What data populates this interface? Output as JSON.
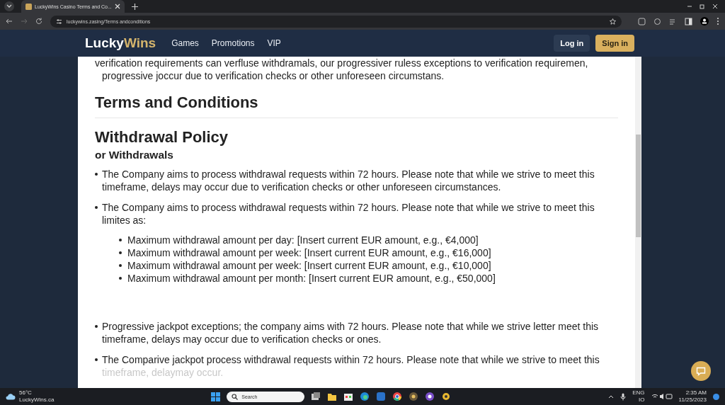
{
  "browser": {
    "tab_title": "LuckyWins Casino Terms and Co...",
    "url": "luckywins.zasing/Terms andconditions"
  },
  "site": {
    "logo_first": "Lucky",
    "logo_second": "Wins",
    "nav": [
      "Games",
      "Promotions",
      "VIP"
    ],
    "login": "Log in",
    "signin": "Sign in"
  },
  "content": {
    "intro": "verification requirements can verfluse withdramals, our progressiver ruless exceptions to verification requiremen, progressive joccur due to verification checks or other unforeseen circumstans.",
    "title": "Terms and Conditions",
    "heading": "Withdrawal Policy",
    "subheading": "or Withdrawals",
    "bullets": [
      {
        "text": "The Company aims to process withdrawal requests within 72 hours. Please note that while we strive to meet this timeframe, delays may occur due to verification checks or other unforeseen circumstances."
      },
      {
        "text": "The Company aims to process withdrawal requests within 72 hours. Please note that while we strive to meet this limites as:",
        "subitems": [
          "Maximum withdrawal amount per day: [Insert current EUR amount, e.g., €4,000]",
          "Maximum withdrawal amount per week: [Insert current EUR amount, e.g., €16,000]",
          "Maximum withdrawal amount per week: [Insert current EUR amount, e.g., €10,000]",
          "Maximum withdrawal amount per month: [Insert current EUR amount, e.g., €50,000]"
        ]
      },
      {
        "text": "Progressive jackpot exceptions; the company aims with 72 hours. Please note that while we strive letter meet this timeframe, delays may occur due to verification checks or ones."
      },
      {
        "text": "The Comparive jackpot process withdrawal requests within 72 hours. Please note that while we strive to meet this",
        "faded": "timeframe, delaymay occur."
      }
    ]
  },
  "taskbar": {
    "weather": "56°C",
    "weather_site": "LuckyWins.ca",
    "search": "Search",
    "lang": "ENG",
    "region": "IO",
    "time": "2:35 AM",
    "date": "11/25/2023"
  }
}
